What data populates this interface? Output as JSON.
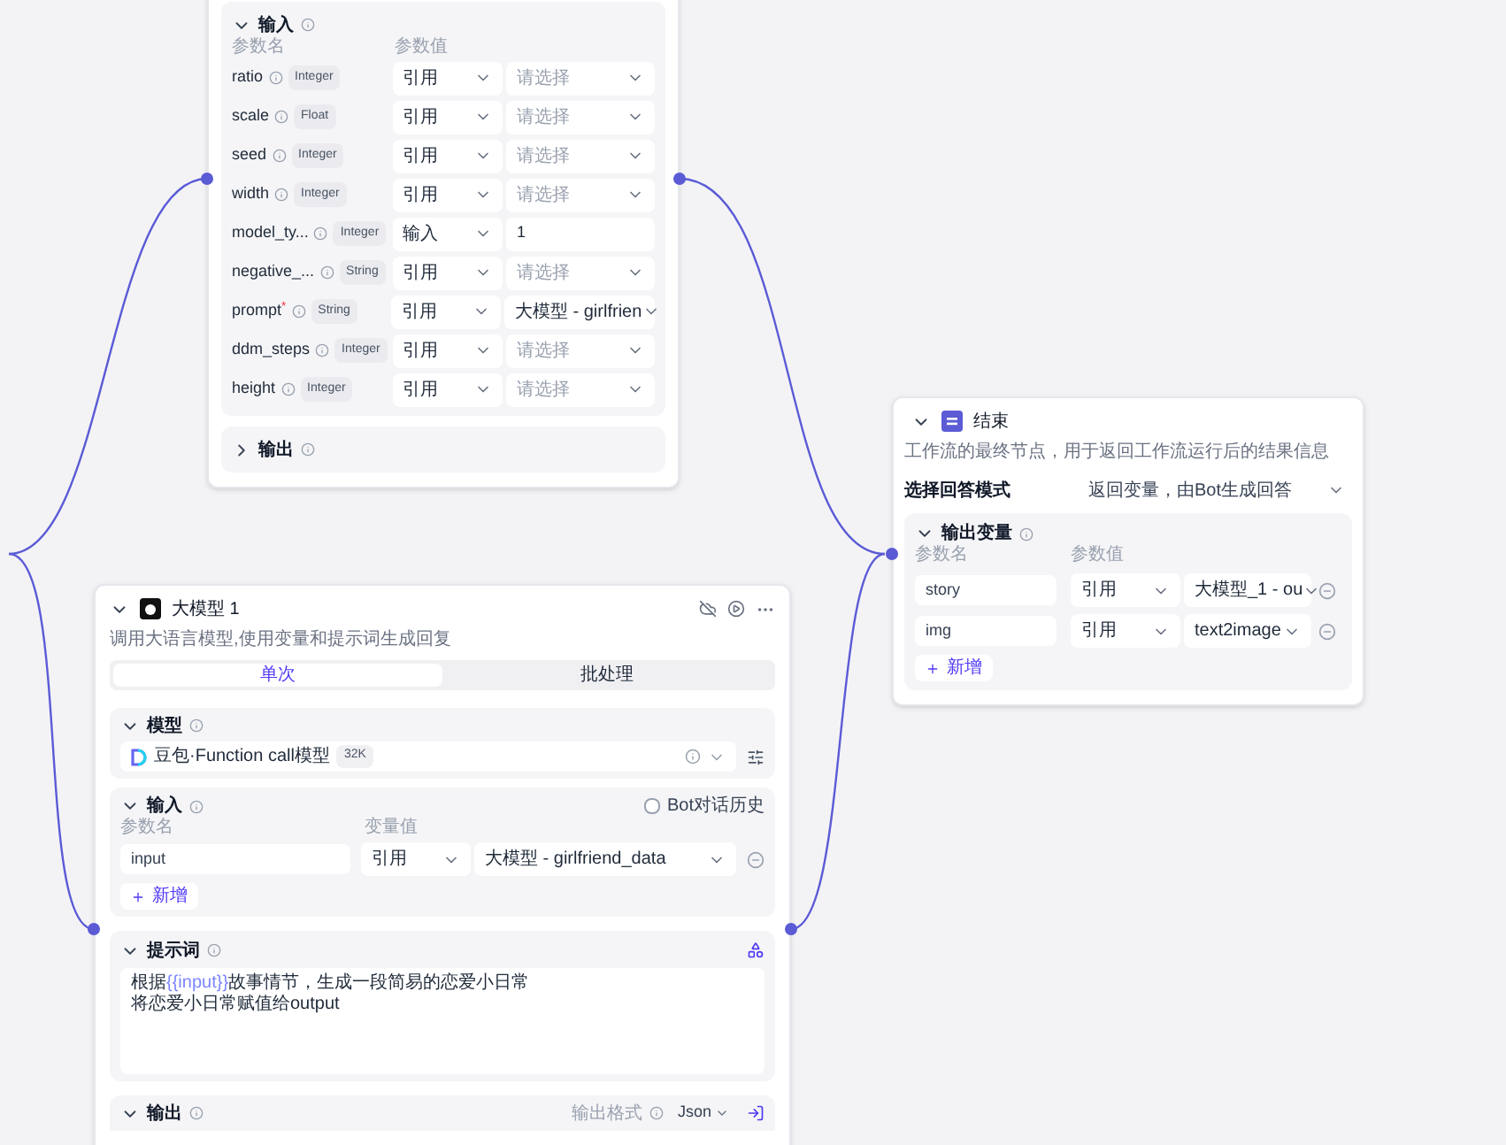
{
  "plugin_node": {
    "input_section": {
      "title": "输入",
      "expanded": true,
      "col_name": "参数名",
      "col_value": "参数值",
      "params": [
        {
          "name": "ratio",
          "type": "Integer",
          "source": "引用",
          "kind": "select",
          "placeholder": "请选择"
        },
        {
          "name": "scale",
          "type": "Float",
          "source": "引用",
          "kind": "select",
          "placeholder": "请选择"
        },
        {
          "name": "seed",
          "type": "Integer",
          "source": "引用",
          "kind": "select",
          "placeholder": "请选择"
        },
        {
          "name": "width",
          "type": "Integer",
          "source": "引用",
          "kind": "select",
          "placeholder": "请选择"
        },
        {
          "name": "model_ty...",
          "type": "Integer",
          "source": "输入",
          "kind": "input",
          "value": "1"
        },
        {
          "name": "negative_...",
          "type": "String",
          "source": "引用",
          "kind": "select",
          "placeholder": "请选择"
        },
        {
          "name": "prompt$^{*}$",
          "type": "String",
          "source": "引用",
          "kind": "select",
          "value": "大模型 - girlfrien"
        },
        {
          "name": "ddm_steps",
          "type": "Integer",
          "source": "引用",
          "kind": "select",
          "placeholder": "请选择"
        },
        {
          "name": "height",
          "type": "Integer",
          "source": "引用",
          "kind": "select",
          "placeholder": "请选择"
        }
      ]
    },
    "output_section": {
      "title": "输出",
      "expanded": false
    }
  },
  "llm_node": {
    "title": "大模型 1",
    "expanded": true,
    "description": "调用大语言模型,使用变量和提示词生成回复",
    "tabs": [
      {
        "label": "单次",
        "selected": true
      },
      {
        "label": "批处理",
        "selected": false
      }
    ],
    "model_section": {
      "title": "模型",
      "model": "豆包·Function call模型",
      "badge": "32K"
    },
    "input_section": {
      "title": "输入",
      "history_label": "Bot对话历史",
      "history_checked": false,
      "col_name": "参数名",
      "col_value": "变量值",
      "rows": [
        {
          "name": "input",
          "source": "引用",
          "value": "大模型 - girlfriend_data"
        }
      ],
      "add_label": "新增"
    },
    "prompt_section": {
      "title": "提示词",
      "lines": [
        [
          {
            "kind": "plain",
            "text": "根据"
          },
          {
            "kind": "var",
            "text": "{{input}}"
          },
          {
            "kind": "plain",
            "text": "故事情节，生成一段简易的恋爱小日常"
          }
        ],
        [
          {
            "kind": "plain",
            "text": "将恋爱小日常赋值给output"
          }
        ]
      ]
    },
    "output_section": {
      "title": "输出",
      "format_label": "输出格式",
      "format": "Json"
    }
  },
  "end_node": {
    "title": "结束",
    "expanded": true,
    "description": "工作流的最终节点，用于返回工作流运行后的结果信息",
    "mode_label": "选择回答模式",
    "mode": "返回变量，由Bot生成回答",
    "output_section": {
      "title": "输出变量",
      "col_name": "参数名",
      "col_value": "参数值",
      "rows": [
        {
          "name": "story",
          "source": "引用",
          "value": "大模型_1 - ou"
        },
        {
          "name": "img",
          "source": "引用",
          "value": "text2image"
        }
      ],
      "add_label": "新增"
    }
  }
}
